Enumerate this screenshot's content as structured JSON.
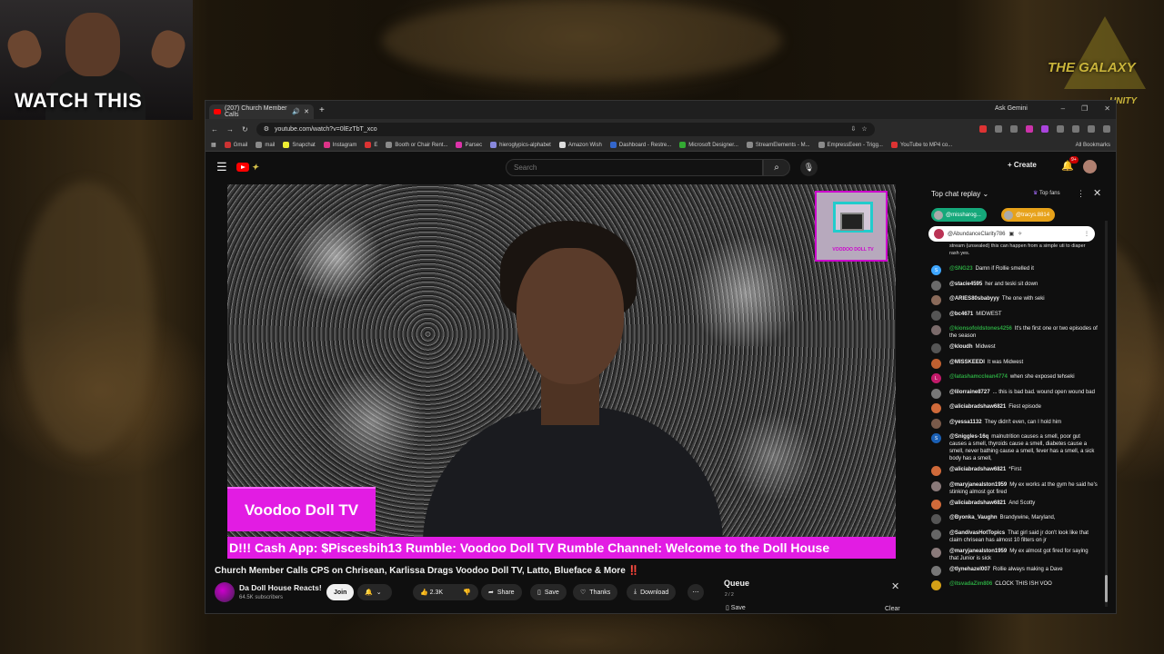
{
  "overlay": {
    "watch_label": "WATCH THIS",
    "galaxy_logo_text": "THE GALAXY",
    "galaxy_logo_sub": "UNITY"
  },
  "browser": {
    "tab_title": "(207) Church Member Calls",
    "ask_gemini": "Ask Gemini",
    "url": "youtube.com/watch?v=0lEzTbT_xco",
    "bookmarks": [
      "Gmail",
      "mail",
      "Snapchat",
      "Instagram",
      "E",
      "Booth or Chair Rent...",
      "Parsec",
      "hieroglypics-alphabet",
      "Amazon Wish",
      "Dashboard - Restre...",
      "Microsoft Designer...",
      "StreamElements - M...",
      "EmpressEeen - Trigg...",
      "YouTube to MP4 co..."
    ],
    "all_bookmarks": "All Bookmarks"
  },
  "youtube": {
    "search_placeholder": "Search",
    "create_label": "Create",
    "notif_count": "9+"
  },
  "video": {
    "pip_brand": "VOODOO DOLL TV",
    "name_banner": "Voodoo Doll TV",
    "ticker": "D!!! Cash App: $Piscesbih13 Rumble: Voodoo Doll TV Rumble Channel: Welcome to the Doll House",
    "title": "Church Member Calls CPS on Chrisean, Karlissa Drags Voodoo Doll TV, Latto, Blueface & More ‼️",
    "channel_name": "Da Doll House Reacts!",
    "subscribers": "64.5K subscribers",
    "join_label": "Join",
    "like_count": "2.3K",
    "share_label": "Share",
    "save_label": "Save",
    "thanks_label": "Thanks",
    "download_label": "Download"
  },
  "queue": {
    "title": "Queue",
    "count": "2 / 2",
    "save_label": "Save",
    "clear_label": "Clear"
  },
  "chat": {
    "header": "Top chat replay",
    "top_fans": "Top fans",
    "chips": [
      "@missharog...",
      "@tracys.8814"
    ],
    "pinned_author": "@AbundanceClarity786",
    "partial_text": "stream (unsealed) this can happen from a simple uti to diaper rash yes.",
    "messages": [
      {
        "author": "@SNG23",
        "text": "Damn if Rollie smelled it",
        "color": "#3ea6ff",
        "author_color": "#2ba640",
        "initial": "S"
      },
      {
        "author": "@stacie4595",
        "text": "her and teski sit down",
        "color": "#6a6a6a",
        "author_color": "#f1f1f1",
        "initial": ""
      },
      {
        "author": "@ARIES80sbabyyy",
        "text": "The one with seki",
        "color": "#8a6a5a",
        "author_color": "#f1f1f1",
        "initial": ""
      },
      {
        "author": "@bc4671",
        "text": "MIDWEST",
        "color": "#555",
        "author_color": "#f1f1f1",
        "initial": ""
      },
      {
        "author": "@kionsofoldstones4256",
        "text": "It's the first one or two episodes of the season",
        "color": "#7a6a6a",
        "author_color": "#2ba640",
        "initial": ""
      },
      {
        "author": "@kloudh",
        "text": "Midwest",
        "color": "#555",
        "author_color": "#f1f1f1",
        "initial": ""
      },
      {
        "author": "@MISSKEEDI",
        "text": "It was Midwest",
        "color": "#c06030",
        "author_color": "#f1f1f1",
        "initial": ""
      },
      {
        "author": "@latashamcclean4774",
        "text": "when she exposed tehseki",
        "color": "#c21a6a",
        "author_color": "#2ba640",
        "initial": "L"
      },
      {
        "author": "@lilorraine8727",
        "text": "... this is bad bad. wound open wound bad",
        "color": "#777",
        "author_color": "#f1f1f1",
        "initial": ""
      },
      {
        "author": "@aliciabradshaw6821",
        "text": "Fiest episode",
        "color": "#d06a3a",
        "author_color": "#f1f1f1",
        "initial": ""
      },
      {
        "author": "@yessa1132",
        "text": "They didn't even, can I hold him",
        "color": "#7a5a4a",
        "author_color": "#f1f1f1",
        "initial": ""
      },
      {
        "author": "@Sniggles-16q",
        "text": "malnutrition causes a smell, poor gut causes a smell, thyroids cause a smell, diabetes cause a smell, never bathing cause a smell, fever has a smell, a sick body has a smell,",
        "color": "#1a5fb4",
        "author_color": "#f1f1f1",
        "initial": "S"
      },
      {
        "author": "@aliciabradshaw6821",
        "text": "*First",
        "color": "#d06a3a",
        "author_color": "#f1f1f1",
        "initial": ""
      },
      {
        "author": "@maryjanealston1959",
        "text": "My ex works at the gym he said he's stinking almost got fired",
        "color": "#8a7a7a",
        "author_color": "#f1f1f1",
        "initial": ""
      },
      {
        "author": "@aliciabradshaw6821",
        "text": "And Scotty",
        "color": "#d06a3a",
        "author_color": "#f1f1f1",
        "initial": ""
      },
      {
        "author": "@Byonka_Vaughn",
        "text": "Brandywine, Maryland,",
        "color": "#555",
        "author_color": "#f1f1f1",
        "initial": ""
      },
      {
        "author": "@SandivasHotTopics",
        "text": "That girl said jr don't look like that claim chrisean has almost 10 filters on jr",
        "color": "#666",
        "author_color": "#f1f1f1",
        "initial": ""
      },
      {
        "author": "@maryjanealston1959",
        "text": "My ex almost got fired for saying that Junior is sick",
        "color": "#8a7a7a",
        "author_color": "#f1f1f1",
        "initial": ""
      },
      {
        "author": "@tlynehazel007",
        "text": "Rollie always making a Dave",
        "color": "#777",
        "author_color": "#f1f1f1",
        "initial": ""
      },
      {
        "author": "@itsvadaZim806",
        "text": "CLOCK THIS ISH VOO",
        "color": "#d4a017",
        "author_color": "#2ba640",
        "initial": ""
      }
    ]
  }
}
